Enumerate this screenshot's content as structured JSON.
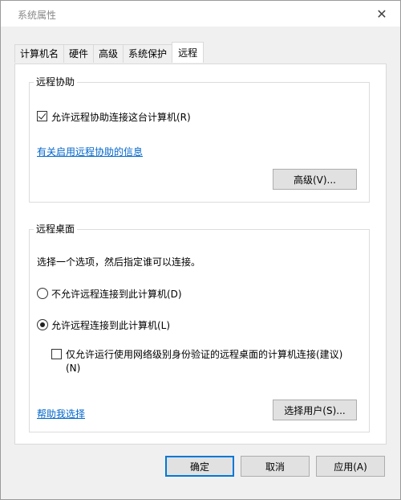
{
  "window": {
    "title": "系统属性",
    "close_symbol": "✕"
  },
  "tabs": [
    {
      "label": "计算机名"
    },
    {
      "label": "硬件"
    },
    {
      "label": "高级"
    },
    {
      "label": "系统保护"
    },
    {
      "label": "远程"
    }
  ],
  "active_tab": "远程",
  "remote_assistance": {
    "title": "远程协助",
    "allow_label": "允许远程协助连接这台计算机(R)",
    "allow_checked": true,
    "info_link": "有关启用远程协助的信息",
    "advanced_button": "高级(V)..."
  },
  "remote_desktop": {
    "title": "远程桌面",
    "prompt": "选择一个选项，然后指定谁可以连接。",
    "option_deny": "不允许远程连接到此计算机(D)",
    "option_allow": "允许远程连接到此计算机(L)",
    "selected_option": "allow",
    "nla_label_line1": "仅允许运行使用网络级别身份验证的远程桌面的计算机连接(建议)",
    "nla_label_line2": "(N)",
    "nla_checked": false,
    "help_link": "帮助我选择",
    "select_users_button": "选择用户(S)..."
  },
  "footer": {
    "ok": "确定",
    "cancel": "取消",
    "apply": "应用(A)"
  }
}
